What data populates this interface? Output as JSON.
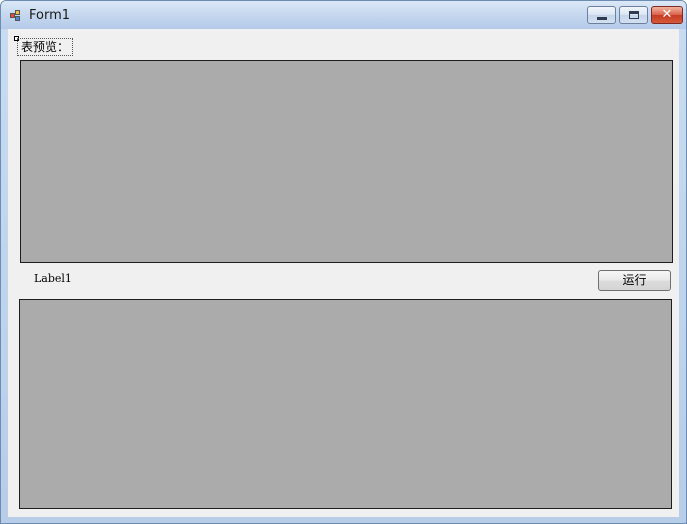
{
  "window": {
    "title": "Form1"
  },
  "form": {
    "preview_label": "表预览：",
    "status_label": "Label1",
    "run_button": "运行"
  },
  "titlebar_controls": {
    "close_glyph": "✕"
  },
  "colors": {
    "grid_background": "#ababab",
    "client_background": "#f0f0f0"
  },
  "icons": {
    "app": "winforms-app-icon",
    "minimize": "minimize-icon",
    "maximize": "maximize-icon",
    "close": "close-icon"
  }
}
